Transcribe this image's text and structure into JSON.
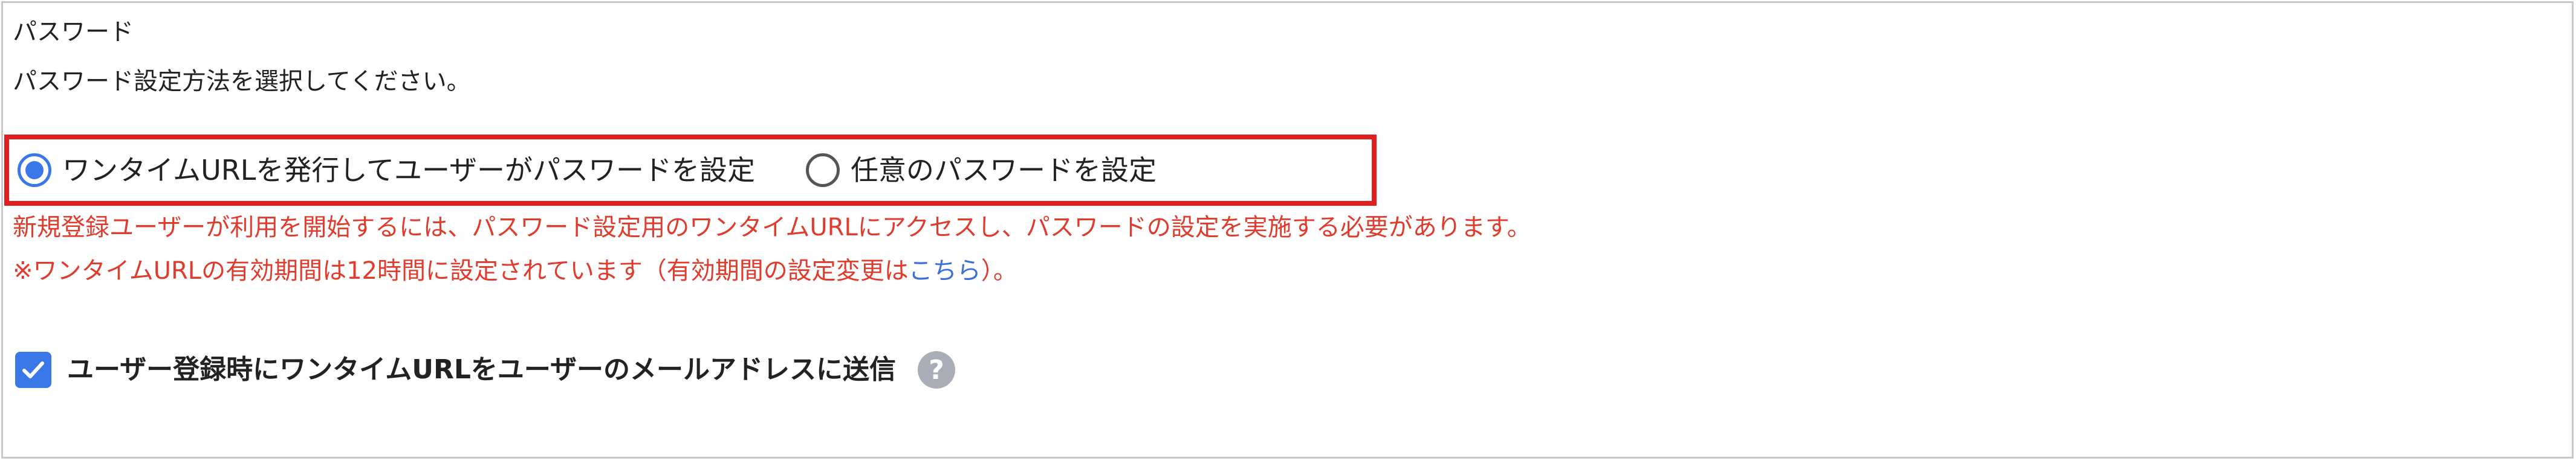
{
  "section": {
    "title": "パスワード",
    "description": "パスワード設定方法を選択してください。"
  },
  "password_method": {
    "options": [
      {
        "label": "ワンタイムURLを発行してユーザーがパスワードを設定",
        "selected": true
      },
      {
        "label": "任意のパスワードを設定",
        "selected": false
      }
    ]
  },
  "notice": {
    "line1": "新規登録ユーザーが利用を開始するには、パスワード設定用のワンタイムURLにアクセスし、パスワードの設定を実施する必要があります。",
    "line2_prefix": "※ワンタイムURLの有効期間は12時間に設定されています（有効期間の設定変更は",
    "line2_link": "こちら",
    "line2_suffix": "）。"
  },
  "send_email": {
    "label": "ユーザー登録時にワンタイムURLをユーザーのメールアドレスに送信",
    "checked": true,
    "help_glyph": "?"
  },
  "colors": {
    "accent": "#3b78e7",
    "highlight_border": "#e02020",
    "notice_text": "#e03c2e",
    "link": "#3b6fd6",
    "help_icon": "#a9adb5"
  },
  "icons": {
    "checkbox": "checkmark-icon",
    "help": "question-circle-icon"
  }
}
